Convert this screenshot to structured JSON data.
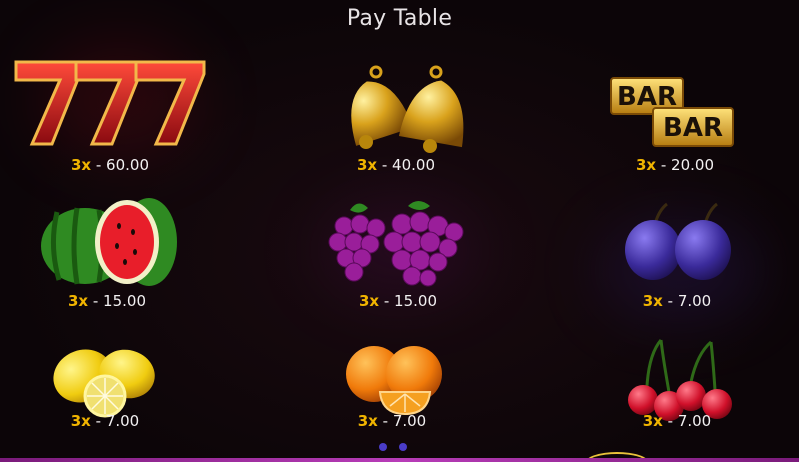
{
  "title": "Pay Table",
  "accent_multiplier_color": "#f0b400",
  "page_indicator_color": "#4a3cc8",
  "symbols": [
    {
      "name": "seven",
      "icon": "triple-seven-icon",
      "multiplier": "3x",
      "payout": " - 60.00"
    },
    {
      "name": "bell",
      "icon": "bells-icon",
      "multiplier": "3x",
      "payout": " - 40.00"
    },
    {
      "name": "bar",
      "icon": "bar-bar-icon",
      "multiplier": "3x",
      "payout": " - 20.00",
      "bar_text": "BAR"
    },
    {
      "name": "watermelon",
      "icon": "watermelon-icon",
      "multiplier": "3x",
      "payout": " - 15.00"
    },
    {
      "name": "grapes",
      "icon": "grapes-icon",
      "multiplier": "3x",
      "payout": " - 15.00"
    },
    {
      "name": "plum",
      "icon": "plums-icon",
      "multiplier": "3x",
      "payout": " - 7.00"
    },
    {
      "name": "lemon",
      "icon": "lemons-icon",
      "multiplier": "3x",
      "payout": " - 7.00"
    },
    {
      "name": "orange",
      "icon": "oranges-icon",
      "multiplier": "3x",
      "payout": " - 7.00"
    },
    {
      "name": "cherry",
      "icon": "cherries-icon",
      "multiplier": "3x",
      "payout": " - 7.00"
    }
  ],
  "pages": {
    "count": 2,
    "current": 1
  }
}
